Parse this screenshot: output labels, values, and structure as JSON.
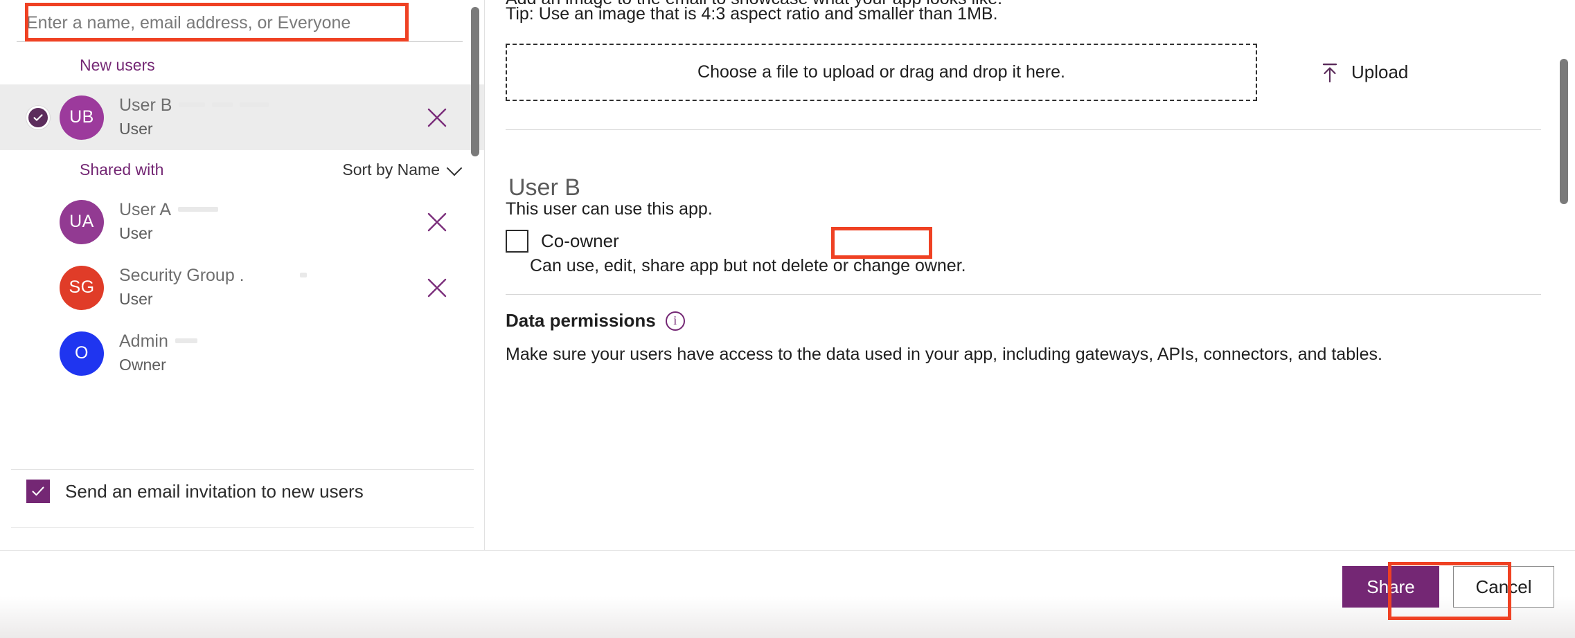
{
  "left_panel": {
    "search": {
      "placeholder": "Enter a name, email address, or Everyone",
      "value": ""
    },
    "new_users_section": {
      "title": "New users"
    },
    "shared_with_section": {
      "title": "Shared with",
      "sort_label": "Sort by Name",
      "sort_chevron_icon": "chevron-down-icon"
    },
    "new_users": [
      {
        "initials": "UB",
        "name": "User B",
        "role": "User",
        "avatar_color": "#9c3a9c",
        "selected": true,
        "check_icon": "check-icon",
        "remove_icon": "close-icon"
      }
    ],
    "shared_with": [
      {
        "initials": "UA",
        "name": "User A",
        "role": "User",
        "avatar_color": "#923a92",
        "selected": false,
        "remove_icon": "close-icon"
      },
      {
        "initials": "SG",
        "name": "Security Group .",
        "role": "User",
        "avatar_color": "#e03c28",
        "selected": false,
        "remove_icon": "close-icon"
      },
      {
        "initials": "O",
        "name": "Admin",
        "role": "Owner",
        "avatar_color": "#1f35f0",
        "selected": false,
        "remove_icon": ""
      }
    ],
    "email_invite": {
      "label": "Send an email invitation to new users",
      "checked": true,
      "check_icon": "check-icon"
    },
    "scrollbar": "vertical-scrollbar"
  },
  "right_panel": {
    "clipped_heading": "Add an image to the email to showcase what your app looks like.",
    "tip": "Tip: Use an image that is 4:3 aspect ratio and smaller than 1MB.",
    "dropzone_label": "Choose a file to upload or drag and drop it here.",
    "upload_button": {
      "label": "Upload",
      "icon": "upload-icon"
    },
    "user_detail": {
      "name": "User B",
      "subtitle": "This user can use this app.",
      "coowner": {
        "label": "Co-owner",
        "checked": false,
        "description": "Can use, edit, share app but not delete or change owner."
      }
    },
    "data_permissions": {
      "title": "Data permissions",
      "info_icon": "info-icon",
      "info_glyph": "i",
      "body": "Make sure your users have access to the data used in your app, including gateways, APIs, connectors, and tables."
    },
    "scrollbar": "vertical-scrollbar"
  },
  "footer": {
    "share_label": "Share",
    "cancel_label": "Cancel"
  },
  "annotations": {
    "color": "#ef4123",
    "targets": [
      "search-input",
      "coowner-checkbox",
      "share-button"
    ]
  },
  "colors": {
    "brand_purple": "#742774",
    "accent_red": "#ef4123",
    "selected_row_bg": "#ececec"
  }
}
